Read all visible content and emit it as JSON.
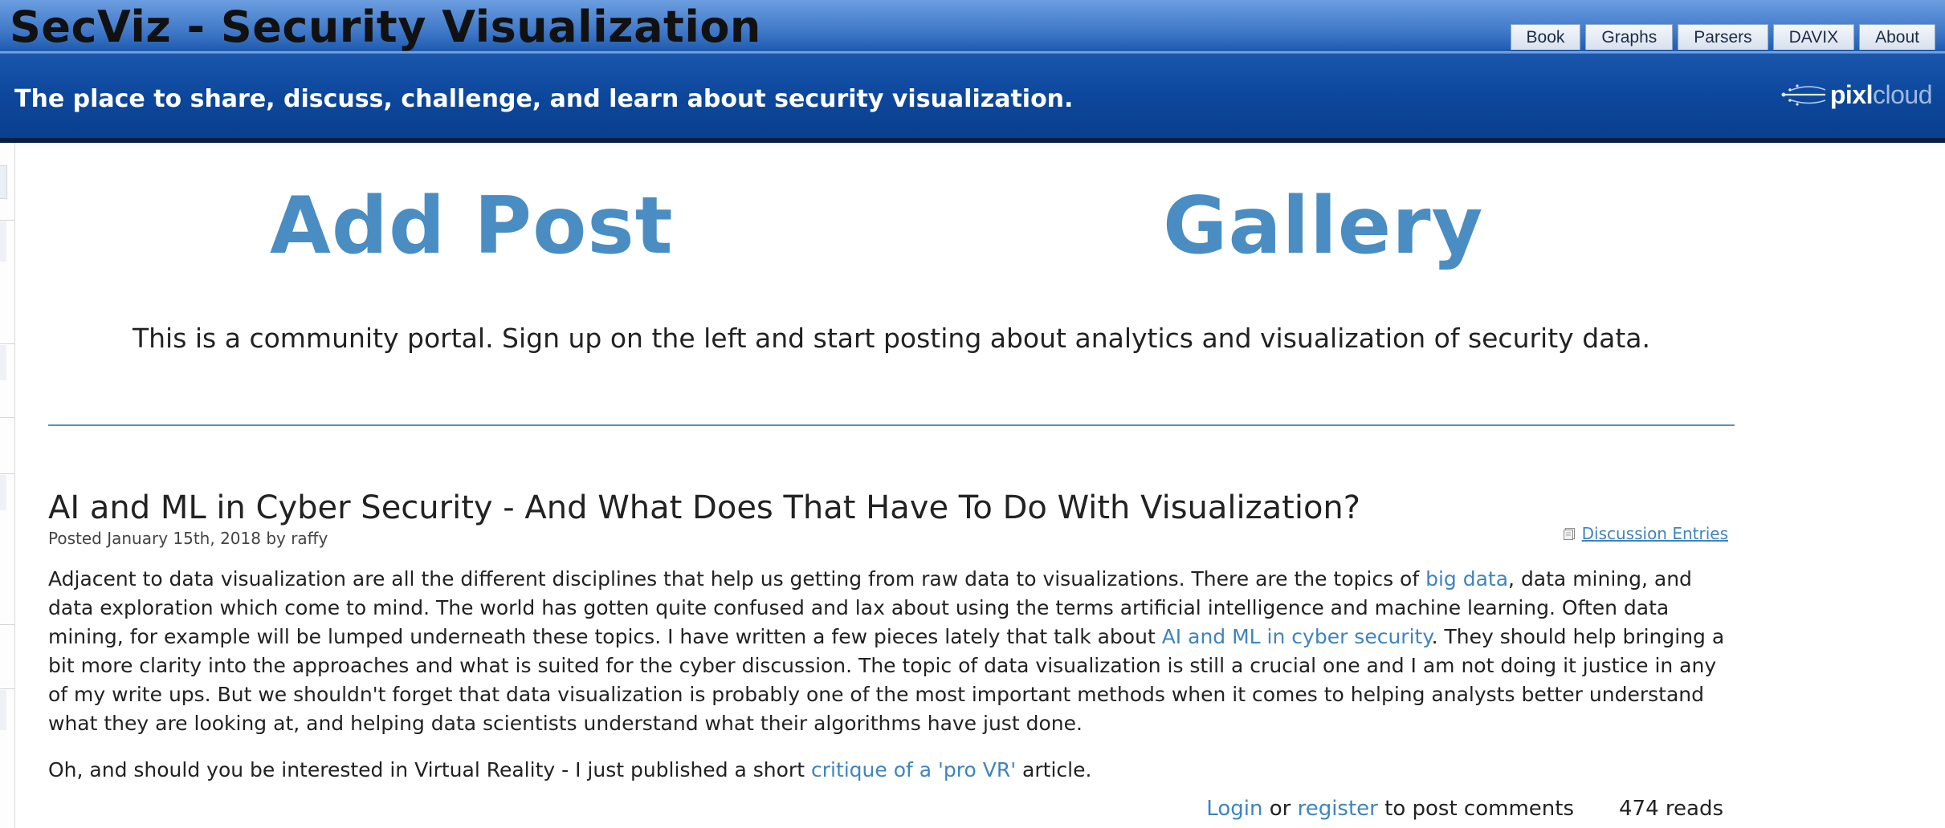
{
  "header": {
    "site_title": "SecViz - Security Visualization",
    "tagline": "The place to share, discuss, challenge, and learn about security visualization.",
    "nav": [
      "Book",
      "Graphs",
      "Parsers",
      "DAVIX",
      "About"
    ],
    "brand": {
      "primary": "pixl",
      "secondary": "cloud"
    }
  },
  "main": {
    "add_post_label": "Add Post",
    "gallery_label": "Gallery",
    "intro": "This is a community portal. Sign up on the left and start posting about analytics and visualization of security data."
  },
  "post": {
    "title": "AI and ML in Cyber Security - And What Does That Have To Do With Visualization?",
    "meta": "Posted January 15th, 2018 by raffy",
    "category": "Discussion Entries",
    "p1": {
      "t1": "Adjacent to data visualization are all the different disciplines that help us getting from raw data to visualizations. There are the topics of ",
      "link1": "big data",
      "t2": ", data mining, and data exploration which come to mind. The world has gotten quite confused and lax about using the terms artificial intelligence and machine learning. Often data mining, for example will be lumped underneath these topics. I have written a few pieces lately that talk about ",
      "link2": "AI and ML in cyber security",
      "t3": ". They should help bringing a bit more clarity into the approaches and what is suited for the cyber discussion. The topic of data visualization is still a crucial one and I am not doing it justice in any of my write ups. But we shouldn't forget that data visualization is probably one of the most important methods when it comes to helping analysts better understand what they are looking at, and helping data scientists understand what their algorithms have just done."
    },
    "p2": {
      "t1": "Oh, and should you be interested in Virtual Reality - I just published a short ",
      "link": "critique of a 'pro VR'",
      "t2": " article."
    },
    "footer": {
      "login": "Login",
      "or": " or ",
      "register": "register",
      "to_post": " to post comments",
      "reads": "474 reads"
    }
  },
  "colors": {
    "header_blue": "#0c479c",
    "cta_blue": "#4a8dc3",
    "link_blue": "#3f84bd",
    "divider": "#5b90b9"
  }
}
